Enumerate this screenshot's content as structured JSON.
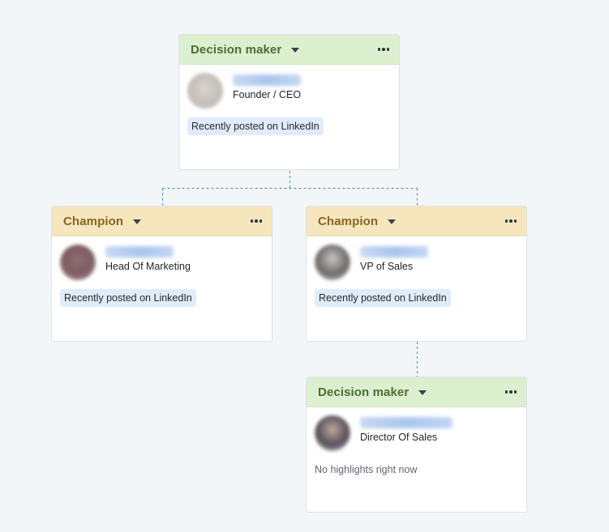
{
  "cards": [
    {
      "role": "Decision maker",
      "title": "Founder / CEO",
      "highlight": "Recently posted on LinkedIn"
    },
    {
      "role": "Champion",
      "title": "Head Of Marketing",
      "highlight": "Recently posted on LinkedIn"
    },
    {
      "role": "Champion",
      "title": "VP of Sales",
      "highlight": "Recently posted on LinkedIn"
    },
    {
      "role": "Decision maker",
      "title": "Director Of Sales",
      "no_highlight": "No highlights right now"
    }
  ],
  "colors": {
    "decision_header": "#dcefcf",
    "champion_header": "#f5e6bd",
    "connector": "#3a86c8",
    "highlight_bg": "#e1ecfa"
  },
  "icons": {
    "role_menu": "caret-down-icon",
    "card_menu": "more-horizontal-icon"
  }
}
